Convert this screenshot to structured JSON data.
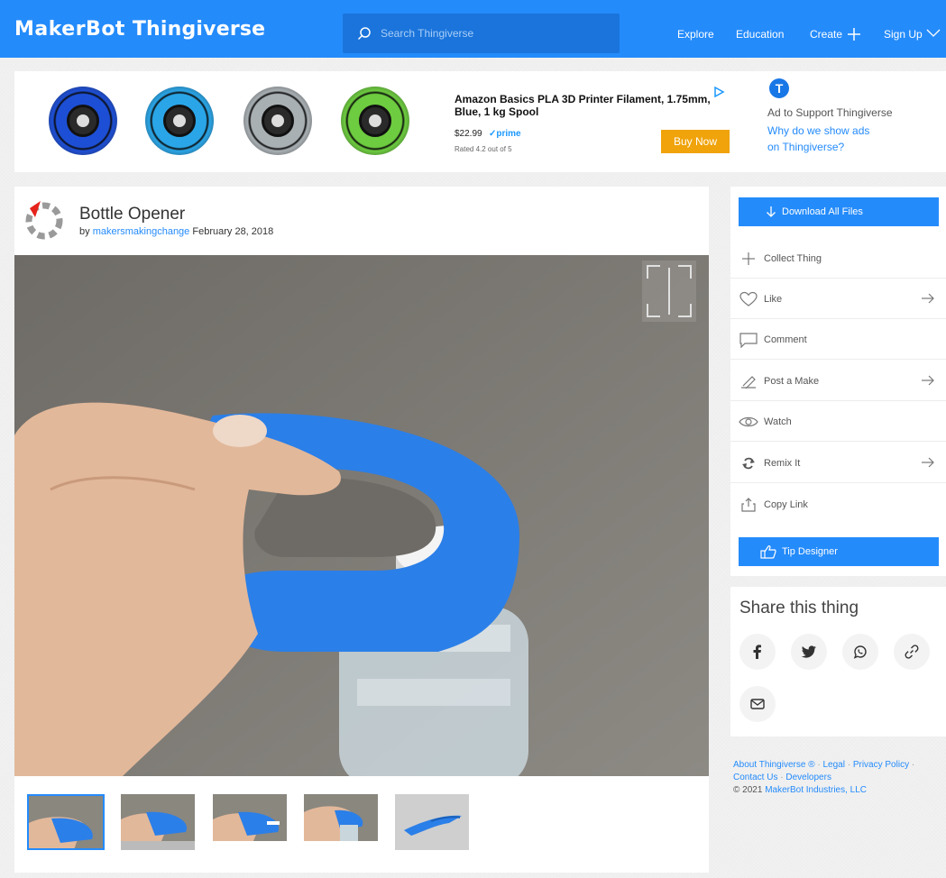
{
  "brand": {
    "maker": "MakerBot",
    "name": "Thingiverse"
  },
  "search": {
    "placeholder": "Search Thingiverse"
  },
  "nav": {
    "explore": "Explore",
    "education": "Education",
    "create": "Create",
    "signup": "Sign Up"
  },
  "ad": {
    "title": "Amazon Basics PLA 3D Printer Filament, 1.75mm, Blue, 1 kg Spool",
    "price": "$22.99",
    "prime": "✓prime",
    "rating": "Rated 4.2 out of 5",
    "buy_label": "Buy Now",
    "support_text": "Ad to Support Thingiverse",
    "why_line1": "Why do we show ads",
    "why_line2": "on Thingiverse?",
    "spool_colors": [
      "#1d4fd6",
      "#2aa6e8",
      "#a9b0b4",
      "#6dcc3f"
    ]
  },
  "thing": {
    "title": "Bottle Opener",
    "by": "by",
    "creator": "makersmakingchange",
    "date": "February 28, 2018"
  },
  "actions": {
    "download": "Download All Files",
    "collect": "Collect Thing",
    "like": "Like",
    "comment": "Comment",
    "post_make": "Post a Make",
    "watch": "Watch",
    "remix": "Remix It",
    "copy_link": "Copy Link",
    "tip": "Tip Designer"
  },
  "share": {
    "title": "Share this thing"
  },
  "footer": {
    "about": "About Thingiverse ®",
    "legal": "Legal",
    "privacy": "Privacy Policy",
    "contact": "Contact Us",
    "developers": "Developers",
    "copyright": "© 2021",
    "company": "MakerBot Industries, LLC"
  },
  "colors": {
    "primary": "#248bfb",
    "buy_button": "#f0a30a",
    "object_blue": "#2b7fe8"
  }
}
